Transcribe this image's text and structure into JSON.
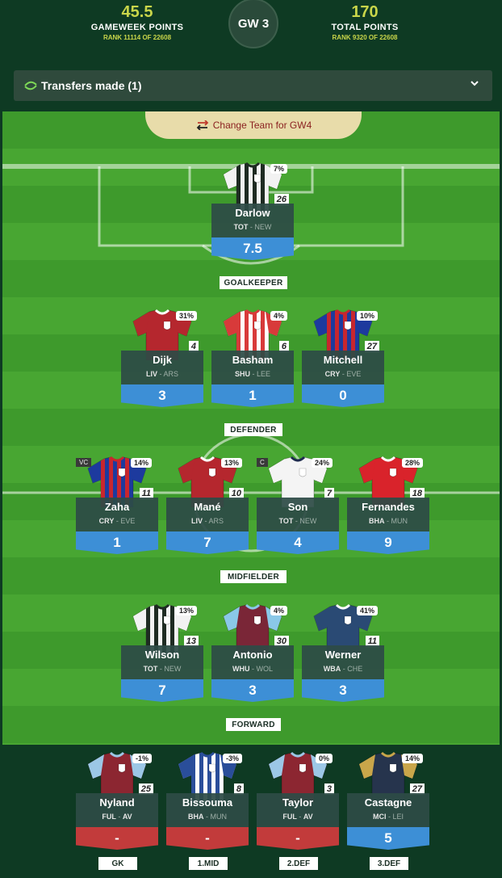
{
  "header": {
    "gameweek_points": "45.5",
    "gameweek_label": "GAMEWEEK POINTS",
    "gameweek_rank": "RANK 11114 OF 22608",
    "gw": "GW 3",
    "total_points": "170",
    "total_label": "TOTAL POINTS",
    "total_rank": "RANK 9320 OF 22608"
  },
  "transfers": {
    "label": "Transfers made (1)"
  },
  "change_team": {
    "label": "Change Team for GW4"
  },
  "positions": {
    "goalkeeper": "GOALKEEPER",
    "defender": "DEFENDER",
    "midfielder": "MIDFIELDER",
    "forward": "FORWARD"
  },
  "starters": [
    {
      "name": "Darlow",
      "team": "TOT",
      "opp": "NEW",
      "points": "7.5",
      "own": "7%",
      "num": "26",
      "shirt": "stripes-bw",
      "tag": ""
    },
    {
      "name": "Dijk",
      "team": "LIV",
      "opp": "ARS",
      "points": "3",
      "own": "31%",
      "num": "4",
      "shirt": "liverpool",
      "tag": ""
    },
    {
      "name": "Basham",
      "team": "SHU",
      "opp": "LEE",
      "points": "1",
      "own": "4%",
      "num": "6",
      "shirt": "stripes-rw",
      "tag": ""
    },
    {
      "name": "Mitchell",
      "team": "CRY",
      "opp": "EVE",
      "points": "0",
      "own": "10%",
      "num": "27",
      "shirt": "palace",
      "tag": ""
    },
    {
      "name": "Zaha",
      "team": "CRY",
      "opp": "EVE",
      "points": "1",
      "own": "14%",
      "num": "11",
      "shirt": "palace",
      "tag": "VC"
    },
    {
      "name": "Mané",
      "team": "LIV",
      "opp": "ARS",
      "points": "7",
      "own": "13%",
      "num": "10",
      "shirt": "liverpool",
      "tag": ""
    },
    {
      "name": "Son",
      "team": "TOT",
      "opp": "NEW",
      "points": "4",
      "own": "24%",
      "num": "7",
      "shirt": "white",
      "tag": "C"
    },
    {
      "name": "Fernandes",
      "team": "BHA",
      "opp": "MUN",
      "points": "9",
      "own": "28%",
      "num": "18",
      "shirt": "united",
      "tag": ""
    },
    {
      "name": "Wilson",
      "team": "TOT",
      "opp": "NEW",
      "points": "7",
      "own": "13%",
      "num": "13",
      "shirt": "stripes-bw",
      "tag": ""
    },
    {
      "name": "Antonio",
      "team": "WHU",
      "opp": "WOL",
      "points": "3",
      "own": "4%",
      "num": "30",
      "shirt": "westham",
      "tag": ""
    },
    {
      "name": "Werner",
      "team": "WBA",
      "opp": "CHE",
      "points": "3",
      "own": "41%",
      "num": "11",
      "shirt": "navy",
      "tag": ""
    }
  ],
  "bench": [
    {
      "name": "Nyland",
      "team": "FUL",
      "opp": "AV",
      "points": "-",
      "own": "-1%",
      "num": "25",
      "shirt": "villa",
      "label": "GK"
    },
    {
      "name": "Bissouma",
      "team": "BHA",
      "opp": "MUN",
      "points": "-",
      "own": "-3%",
      "num": "8",
      "shirt": "stripes-bluew",
      "label": "1.MID"
    },
    {
      "name": "Taylor",
      "team": "FUL",
      "opp": "AV",
      "points": "-",
      "own": "0%",
      "num": "3",
      "shirt": "villa",
      "label": "2.DEF"
    },
    {
      "name": "Castagne",
      "team": "MCI",
      "opp": "LEI",
      "points": "5",
      "own": "14%",
      "num": "27",
      "shirt": "navygold",
      "label": "3.DEF"
    }
  ],
  "colors": {
    "accent": "#c9d64a",
    "points_blue": "#3d8fd6",
    "points_red": "#c23b3b",
    "background": "#0e3a23"
  }
}
